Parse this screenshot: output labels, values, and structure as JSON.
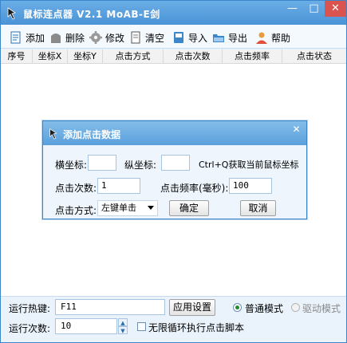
{
  "window": {
    "title": "鼠标连点器 V2.1 MoAB-E剑",
    "min_icon": "minimize-icon",
    "max_icon": "maximize-icon",
    "close_icon": "close-icon"
  },
  "toolbar": {
    "add": "添加",
    "delete": "删除",
    "edit": "修改",
    "clear": "清空",
    "import": "导入",
    "export": "导出",
    "help": "帮助"
  },
  "table": {
    "columns": [
      "序号",
      "坐标X",
      "坐标Y",
      "点击方式",
      "点击次数",
      "点击频率",
      "点击状态"
    ]
  },
  "dialog": {
    "title": "添加点击数据",
    "x_label": "横坐标:",
    "x_value": "",
    "y_label": "纵坐标:",
    "y_value": "",
    "hint": "Ctrl+Q获取当前鼠标坐标",
    "count_label": "点击次数:",
    "count_value": "1",
    "freq_label": "点击频率(毫秒):",
    "freq_value": "100",
    "mode_label": "点击方式:",
    "mode_value": "左键单击",
    "ok": "确定",
    "cancel": "取消"
  },
  "bottom": {
    "hotkey_label": "运行热键:",
    "hotkey_value": "F11",
    "apply_button": "应用设置",
    "mode_normal": "普通模式",
    "mode_driver": "驱动模式",
    "mode_selected": "普通模式",
    "runs_label": "运行次数:",
    "runs_value": "10",
    "infinite_label": "无限循环执行点击脚本",
    "infinite_checked": false
  },
  "colors": {
    "titlebar": "#4a93d6",
    "accent": "#3a86c8",
    "close": "#d9534f",
    "radio_selected": "#1b8f2c"
  }
}
